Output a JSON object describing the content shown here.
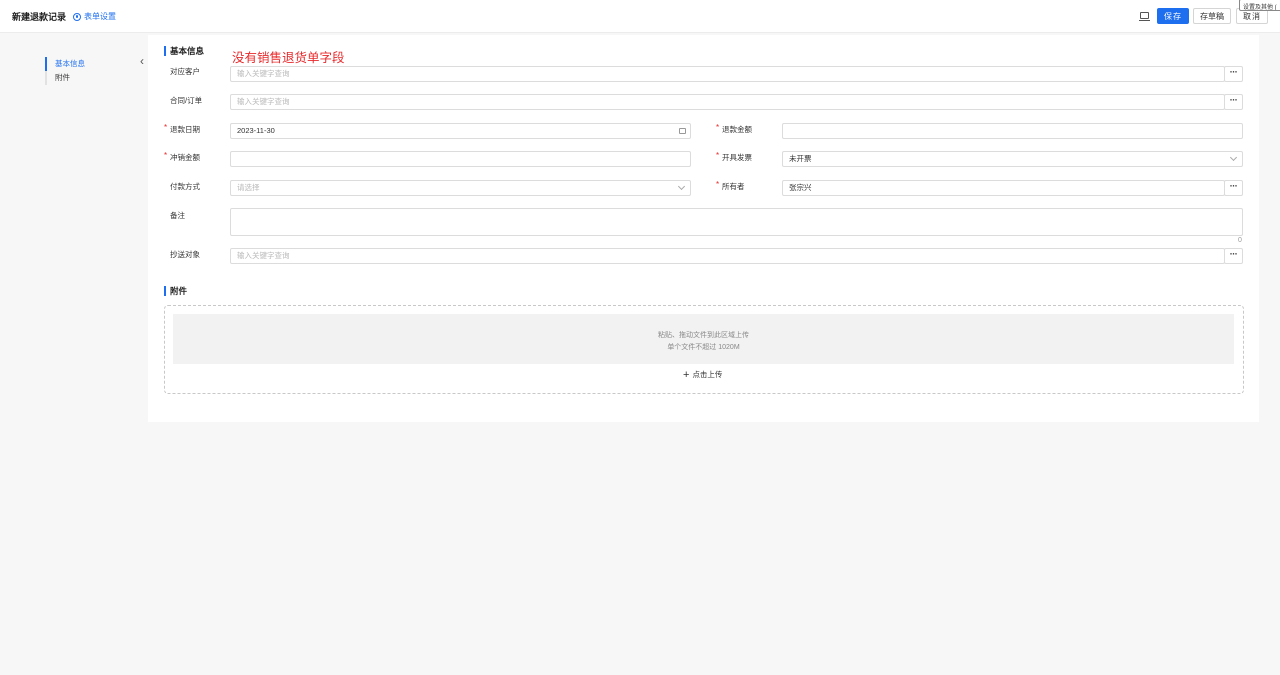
{
  "header": {
    "title": "新建退款记录",
    "form_settings_label": "表单设置",
    "save_label": "保存",
    "draft_label": "存草稿",
    "cancel_label": "取消",
    "tooltip": "设置及其他 (",
    "accent_color": "#1e6ff0"
  },
  "sidebar": {
    "items": [
      {
        "label": "基本信息",
        "active": true
      },
      {
        "label": "附件",
        "active": false
      }
    ]
  },
  "basic_info": {
    "title": "基本信息",
    "annotation": "没有销售退货单字段",
    "customer": {
      "label": "对应客户",
      "placeholder": "输入关键字查询"
    },
    "contract": {
      "label": "合同/订单",
      "placeholder": "输入关键字查询"
    },
    "refund_date": {
      "label": "退款日期",
      "value": "2023-11-30",
      "required": true
    },
    "refund_amount": {
      "label": "退款金额",
      "value": "",
      "required": true
    },
    "offset_amount": {
      "label": "冲销金额",
      "value": "",
      "required": true
    },
    "invoice": {
      "label": "开具发票",
      "value": "未开票",
      "required": true
    },
    "payment_method": {
      "label": "付款方式",
      "placeholder": "请选择"
    },
    "owner": {
      "label": "所有者",
      "value": "张宗兴",
      "required": true
    },
    "remark": {
      "label": "备注",
      "counter": "0"
    },
    "cc": {
      "label": "抄送对象",
      "placeholder": "输入关键字查询"
    }
  },
  "attachments": {
    "title": "附件",
    "drop_hint": "粘贴、拖动文件到此区域上传",
    "size_limit": "单个文件不超过 1020M",
    "click_upload": "点击上传"
  }
}
